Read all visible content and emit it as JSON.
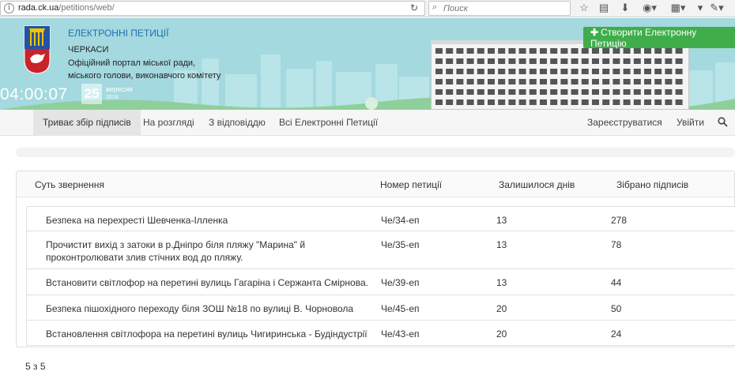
{
  "browser": {
    "url_host": "rada.ck.ua",
    "url_path": "/petitions/web/",
    "search_placeholder": "Поиск"
  },
  "header": {
    "title": "ЕЛЕКТРОННІ ПЕТИЦІЇ",
    "city": "ЧЕРКАСИ",
    "portal_line1": "Офіційний портал міської ради,",
    "portal_line2": "міського голови, виконавчого комітету",
    "clock": "04:00:07",
    "day": "25",
    "month": "вересня",
    "year": "2016",
    "create_button": "Створити Електронну Петицію"
  },
  "nav": {
    "tabs": [
      "Триває збір підписів",
      "На розгляді",
      "З відповіддю",
      "Всі Електронні Петиції"
    ],
    "register": "Зареєструватися",
    "login": "Увійти"
  },
  "table": {
    "headers": [
      "Суть звернення",
      "Номер петиції",
      "Залишилося днів",
      "Зібрано підписів"
    ],
    "rows": [
      {
        "title": "Безпека на перехресті Шевченка-Ілленка",
        "number": "Че/34-еп",
        "days": "13",
        "signatures": "278"
      },
      {
        "title": "Прочистит вихід з затоки в р.Дніпро біля пляжу \"Марина\" й проконтролювати злив стічних вод до пляжу.",
        "number": "Че/35-еп",
        "days": "13",
        "signatures": "78"
      },
      {
        "title": "Встановити світлофор на перетині вулиць Гагаріна і Сержанта Смірнова.",
        "number": "Че/39-еп",
        "days": "13",
        "signatures": "44"
      },
      {
        "title": "Безпека пішохідного переходу біля ЗОШ №18 по вулиці В. Чорновола",
        "number": "Че/45-еп",
        "days": "20",
        "signatures": "50"
      },
      {
        "title": "Встановлення світлофора на перетині вулиць Чигиринська - Будіндустрії",
        "number": "Че/43-еп",
        "days": "20",
        "signatures": "24"
      }
    ]
  },
  "pager": "5 з 5",
  "colors": {
    "accent": "#3fae4a",
    "header_bg": "#a3d9df",
    "title_blue": "#1f6fb2"
  }
}
